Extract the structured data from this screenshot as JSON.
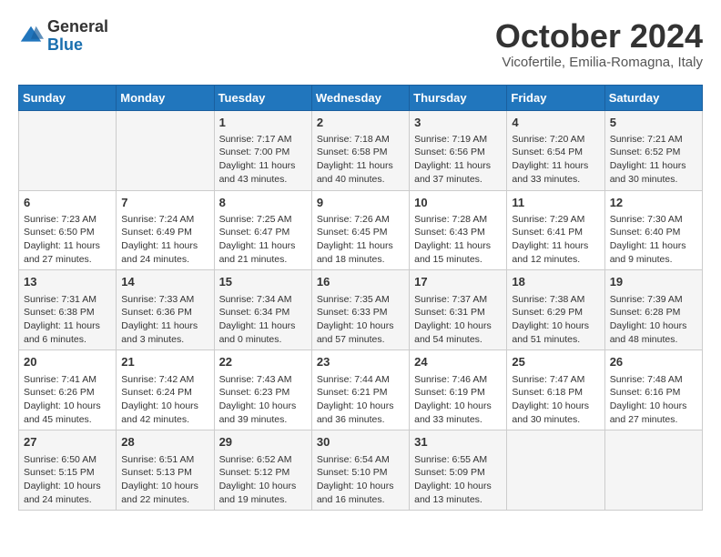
{
  "header": {
    "logo_general": "General",
    "logo_blue": "Blue",
    "month_title": "October 2024",
    "subtitle": "Vicofertile, Emilia-Romagna, Italy"
  },
  "days_of_week": [
    "Sunday",
    "Monday",
    "Tuesday",
    "Wednesday",
    "Thursday",
    "Friday",
    "Saturday"
  ],
  "weeks": [
    [
      {
        "day": "",
        "info": ""
      },
      {
        "day": "",
        "info": ""
      },
      {
        "day": "1",
        "info": "Sunrise: 7:17 AM\nSunset: 7:00 PM\nDaylight: 11 hours and 43 minutes."
      },
      {
        "day": "2",
        "info": "Sunrise: 7:18 AM\nSunset: 6:58 PM\nDaylight: 11 hours and 40 minutes."
      },
      {
        "day": "3",
        "info": "Sunrise: 7:19 AM\nSunset: 6:56 PM\nDaylight: 11 hours and 37 minutes."
      },
      {
        "day": "4",
        "info": "Sunrise: 7:20 AM\nSunset: 6:54 PM\nDaylight: 11 hours and 33 minutes."
      },
      {
        "day": "5",
        "info": "Sunrise: 7:21 AM\nSunset: 6:52 PM\nDaylight: 11 hours and 30 minutes."
      }
    ],
    [
      {
        "day": "6",
        "info": "Sunrise: 7:23 AM\nSunset: 6:50 PM\nDaylight: 11 hours and 27 minutes."
      },
      {
        "day": "7",
        "info": "Sunrise: 7:24 AM\nSunset: 6:49 PM\nDaylight: 11 hours and 24 minutes."
      },
      {
        "day": "8",
        "info": "Sunrise: 7:25 AM\nSunset: 6:47 PM\nDaylight: 11 hours and 21 minutes."
      },
      {
        "day": "9",
        "info": "Sunrise: 7:26 AM\nSunset: 6:45 PM\nDaylight: 11 hours and 18 minutes."
      },
      {
        "day": "10",
        "info": "Sunrise: 7:28 AM\nSunset: 6:43 PM\nDaylight: 11 hours and 15 minutes."
      },
      {
        "day": "11",
        "info": "Sunrise: 7:29 AM\nSunset: 6:41 PM\nDaylight: 11 hours and 12 minutes."
      },
      {
        "day": "12",
        "info": "Sunrise: 7:30 AM\nSunset: 6:40 PM\nDaylight: 11 hours and 9 minutes."
      }
    ],
    [
      {
        "day": "13",
        "info": "Sunrise: 7:31 AM\nSunset: 6:38 PM\nDaylight: 11 hours and 6 minutes."
      },
      {
        "day": "14",
        "info": "Sunrise: 7:33 AM\nSunset: 6:36 PM\nDaylight: 11 hours and 3 minutes."
      },
      {
        "day": "15",
        "info": "Sunrise: 7:34 AM\nSunset: 6:34 PM\nDaylight: 11 hours and 0 minutes."
      },
      {
        "day": "16",
        "info": "Sunrise: 7:35 AM\nSunset: 6:33 PM\nDaylight: 10 hours and 57 minutes."
      },
      {
        "day": "17",
        "info": "Sunrise: 7:37 AM\nSunset: 6:31 PM\nDaylight: 10 hours and 54 minutes."
      },
      {
        "day": "18",
        "info": "Sunrise: 7:38 AM\nSunset: 6:29 PM\nDaylight: 10 hours and 51 minutes."
      },
      {
        "day": "19",
        "info": "Sunrise: 7:39 AM\nSunset: 6:28 PM\nDaylight: 10 hours and 48 minutes."
      }
    ],
    [
      {
        "day": "20",
        "info": "Sunrise: 7:41 AM\nSunset: 6:26 PM\nDaylight: 10 hours and 45 minutes."
      },
      {
        "day": "21",
        "info": "Sunrise: 7:42 AM\nSunset: 6:24 PM\nDaylight: 10 hours and 42 minutes."
      },
      {
        "day": "22",
        "info": "Sunrise: 7:43 AM\nSunset: 6:23 PM\nDaylight: 10 hours and 39 minutes."
      },
      {
        "day": "23",
        "info": "Sunrise: 7:44 AM\nSunset: 6:21 PM\nDaylight: 10 hours and 36 minutes."
      },
      {
        "day": "24",
        "info": "Sunrise: 7:46 AM\nSunset: 6:19 PM\nDaylight: 10 hours and 33 minutes."
      },
      {
        "day": "25",
        "info": "Sunrise: 7:47 AM\nSunset: 6:18 PM\nDaylight: 10 hours and 30 minutes."
      },
      {
        "day": "26",
        "info": "Sunrise: 7:48 AM\nSunset: 6:16 PM\nDaylight: 10 hours and 27 minutes."
      }
    ],
    [
      {
        "day": "27",
        "info": "Sunrise: 6:50 AM\nSunset: 5:15 PM\nDaylight: 10 hours and 24 minutes."
      },
      {
        "day": "28",
        "info": "Sunrise: 6:51 AM\nSunset: 5:13 PM\nDaylight: 10 hours and 22 minutes."
      },
      {
        "day": "29",
        "info": "Sunrise: 6:52 AM\nSunset: 5:12 PM\nDaylight: 10 hours and 19 minutes."
      },
      {
        "day": "30",
        "info": "Sunrise: 6:54 AM\nSunset: 5:10 PM\nDaylight: 10 hours and 16 minutes."
      },
      {
        "day": "31",
        "info": "Sunrise: 6:55 AM\nSunset: 5:09 PM\nDaylight: 10 hours and 13 minutes."
      },
      {
        "day": "",
        "info": ""
      },
      {
        "day": "",
        "info": ""
      }
    ]
  ]
}
